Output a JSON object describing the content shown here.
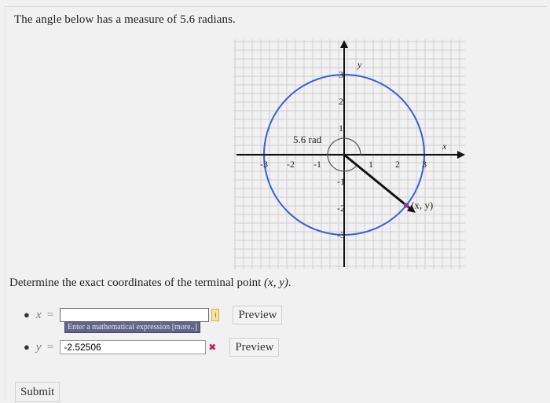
{
  "problem": {
    "intro": "The angle below has a measure of 5.6 radians.",
    "question_prefix": "Determine the exact coordinates of the terminal point ",
    "question_math": "(x, y)",
    "question_suffix": "."
  },
  "graph": {
    "x_axis_label": "x",
    "y_axis_label": "y",
    "x_ticks": [
      "-3",
      "-2",
      "-1",
      "1",
      "2",
      "3"
    ],
    "y_ticks": [
      "3",
      "2",
      "1",
      "-1",
      "-2",
      "-3"
    ],
    "angle_label": "5.6 rad",
    "point_label": "(x, y)",
    "circle_color": "#3b5fd6",
    "angle_radians": 5.6,
    "radius": 3
  },
  "answers": {
    "x": {
      "label": "x",
      "equals": "=",
      "value": "",
      "tooltip": "Enter a mathematical expression [more..]",
      "status_icon": "info-icon",
      "status_glyph": "i"
    },
    "y": {
      "label": "y",
      "equals": "=",
      "value": "-2.52506",
      "status_icon": "incorrect-icon",
      "status_glyph": "✖"
    }
  },
  "buttons": {
    "preview": "Preview",
    "submit": "Submit"
  }
}
